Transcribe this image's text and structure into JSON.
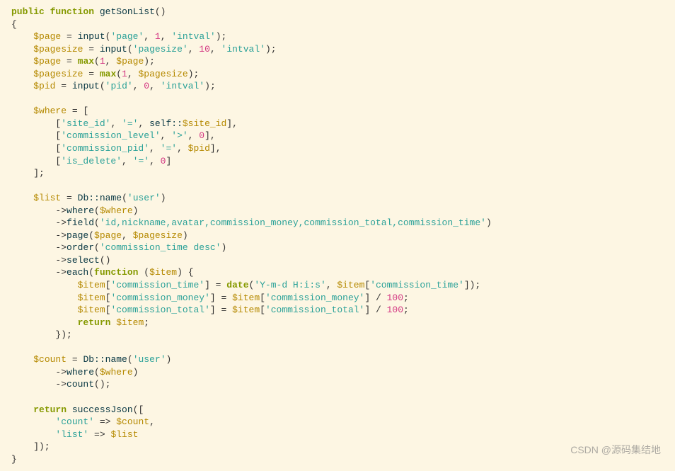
{
  "code": {
    "l01": {
      "kw1": "public",
      "kw2": "function",
      "fn": "getSonList"
    },
    "l03": {
      "var": "$page",
      "f": "input",
      "s": "'page'",
      "n": "1",
      "s2": "'intval'"
    },
    "l04": {
      "var": "$pagesize",
      "f": "input",
      "s": "'pagesize'",
      "n": "10",
      "s2": "'intval'"
    },
    "l05": {
      "var": "$page",
      "f": "max",
      "n": "1",
      "var2": "$page"
    },
    "l06": {
      "var": "$pagesize",
      "f": "max",
      "n": "1",
      "var2": "$pagesize"
    },
    "l07": {
      "var": "$pid",
      "f": "input",
      "s": "'pid'",
      "n": "0",
      "s2": "'intval'"
    },
    "l09": {
      "var": "$where"
    },
    "l10": {
      "s1": "'site_id'",
      "s2": "'='",
      "scope": "self::",
      "var": "$site_id"
    },
    "l11": {
      "s1": "'commission_level'",
      "s2": "'>'",
      "n": "0"
    },
    "l12": {
      "s1": "'commission_pid'",
      "s2": "'='",
      "var": "$pid"
    },
    "l13": {
      "s1": "'is_delete'",
      "s2": "'='",
      "n": "0"
    },
    "l16": {
      "var": "$list",
      "scope": "Db::",
      "f": "name",
      "s": "'user'"
    },
    "l17": {
      "f": "where",
      "var": "$where"
    },
    "l18": {
      "f": "field",
      "s": "'id,nickname,avatar,commission_money,commission_total,commission_time'"
    },
    "l19": {
      "f": "page",
      "var1": "$page",
      "var2": "$pagesize"
    },
    "l20": {
      "f": "order",
      "s": "'commission_time desc'"
    },
    "l21": {
      "f": "select"
    },
    "l22": {
      "f": "each",
      "kw": "function",
      "var": "$item"
    },
    "l23": {
      "var": "$item",
      "k": "'commission_time'",
      "f": "date",
      "s": "'Y-m-d H:i:s'",
      "var2": "$item",
      "k2": "'commission_time'"
    },
    "l24": {
      "var": "$item",
      "k": "'commission_money'",
      "var2": "$item",
      "k2": "'commission_money'",
      "n": "100"
    },
    "l25": {
      "var": "$item",
      "k": "'commission_total'",
      "var2": "$item",
      "k2": "'commission_total'",
      "n": "100"
    },
    "l26": {
      "kw": "return",
      "var": "$item"
    },
    "l29": {
      "var": "$count",
      "scope": "Db::",
      "f": "name",
      "s": "'user'"
    },
    "l30": {
      "f": "where",
      "var": "$where"
    },
    "l31": {
      "f": "count"
    },
    "l33": {
      "kw": "return",
      "f": "successJson"
    },
    "l34": {
      "s": "'count'",
      "var": "$count"
    },
    "l35": {
      "s": "'list'",
      "var": "$list"
    }
  },
  "watermark": "CSDN @源码集结地"
}
